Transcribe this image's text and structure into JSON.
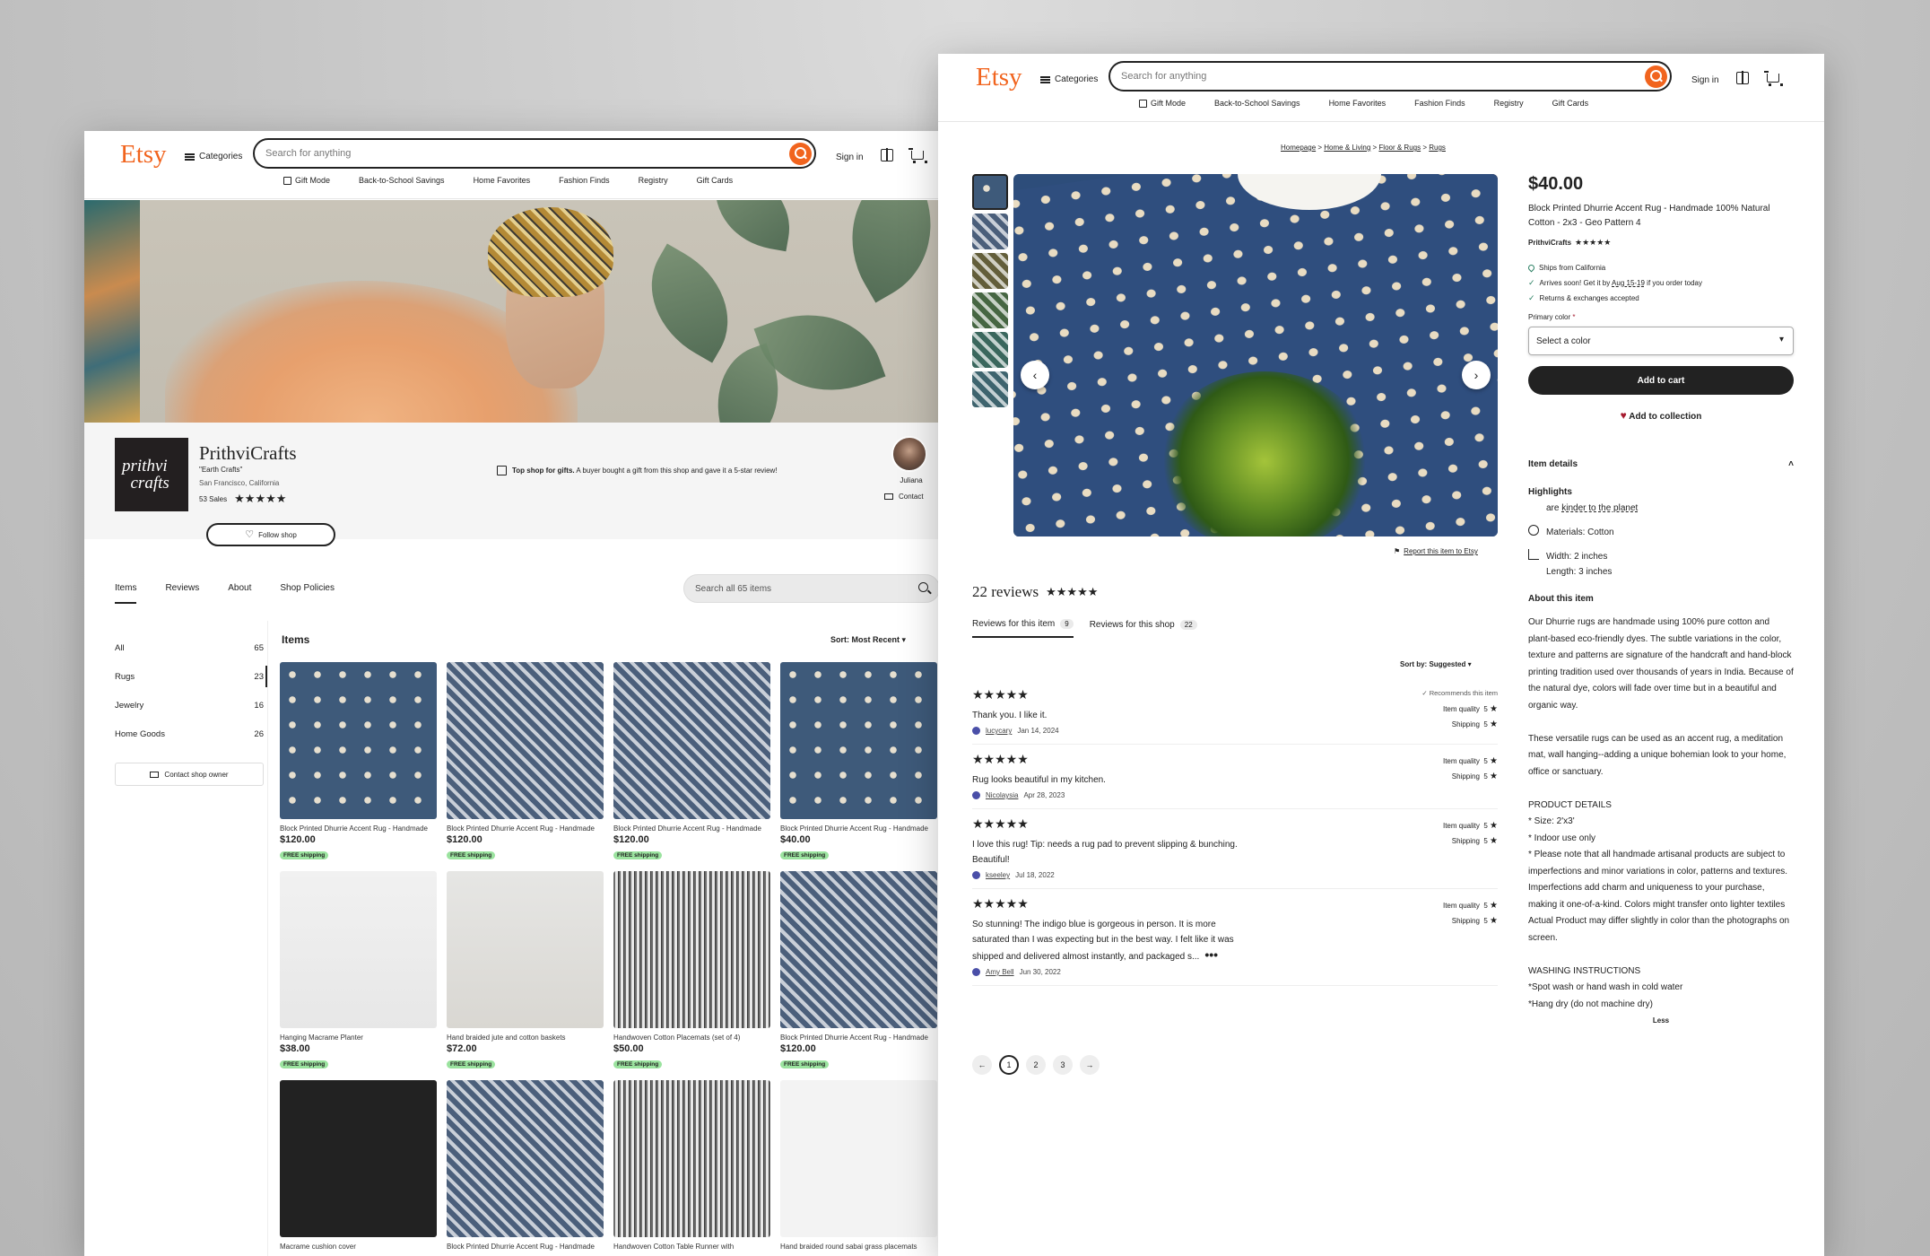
{
  "header": {
    "logo": "Etsy",
    "categories": "Categories",
    "search_placeholder": "Search for anything",
    "sign_in": "Sign in",
    "subnav": [
      "Gift Mode",
      "Back-to-School Savings",
      "Home Favorites",
      "Fashion Finds",
      "Registry",
      "Gift Cards"
    ]
  },
  "shop": {
    "logo_line1": "prithvi",
    "logo_line2": "crafts",
    "name": "PrithviCrafts",
    "tagline": "\"Earth Crafts\"",
    "location": "San Francisco, California",
    "sales": "53 Sales",
    "rating_stars": "★★★★★",
    "top_shop_bold": "Top shop for gifts.",
    "top_shop_text": " A buyer bought a gift from this shop and gave it a 5-star review!",
    "owner_name": "Juliana",
    "contact": "Contact",
    "follow": "Follow shop",
    "tabs": [
      "Items",
      "Reviews",
      "About",
      "Shop Policies"
    ],
    "search_placeholder": "Search all 65 items",
    "categories": [
      {
        "label": "All",
        "count": "65"
      },
      {
        "label": "Rugs",
        "count": "23"
      },
      {
        "label": "Jewelry",
        "count": "16"
      },
      {
        "label": "Home Goods",
        "count": "26"
      }
    ],
    "contact_owner": "Contact shop owner",
    "items_title": "Items",
    "sort": "Sort: Most Recent",
    "free_shipping": "FREE shipping",
    "listings": [
      {
        "title": "Block Printed Dhurrie Accent Rug - Handmade",
        "price": "$120.00",
        "style": "rug-blue"
      },
      {
        "title": "Block Printed Dhurrie Accent Rug - Handmade",
        "price": "$120.00",
        "style": "rug-denim"
      },
      {
        "title": "Block Printed Dhurrie Accent Rug - Handmade",
        "price": "$120.00",
        "style": "rug-denim"
      },
      {
        "title": "Block Printed Dhurrie Accent Rug - Handmade",
        "price": "$40.00",
        "style": "rug-blue"
      },
      {
        "title": "Hanging Macrame Planter",
        "price": "$38.00",
        "style": "white-wall"
      },
      {
        "title": "Hand braided jute and cotton baskets",
        "price": "$72.00",
        "style": "basket"
      },
      {
        "title": "Handwoven Cotton Placemats (set of 4)",
        "price": "$50.00",
        "style": "mat-grey"
      },
      {
        "title": "Block Printed Dhurrie Accent Rug - Handmade",
        "price": "$120.00",
        "style": "rug-denim"
      },
      {
        "title": "Macrame cushion cover",
        "price": "",
        "style": "black-bg"
      },
      {
        "title": "Block Printed Dhurrie Accent Rug - Handmade",
        "price": "",
        "style": "rug-denim"
      },
      {
        "title": "Handwoven Cotton Table Runner with",
        "price": "",
        "style": "mat-grey"
      },
      {
        "title": "Hand braided round sabai grass placemats",
        "price": "",
        "style": "brown-mats"
      }
    ]
  },
  "item": {
    "breadcrumbs": [
      "Homepage",
      "Home & Living",
      "Floor & Rugs",
      "Rugs"
    ],
    "report": "Report this item to Etsy",
    "reviews_count": "22 reviews",
    "review_tabs": [
      {
        "label": "Reviews for this item",
        "count": "9"
      },
      {
        "label": "Reviews for this shop",
        "count": "22"
      }
    ],
    "sort_by": "Sort by: Suggested",
    "recommends": "Recommends this item",
    "item_quality": "Item quality",
    "shipping": "Shipping",
    "reviews": [
      {
        "text": "Thank you. I like it.",
        "user": "lucycary",
        "date": "Jan 14, 2024",
        "q": "5",
        "s": "5",
        "rec": true
      },
      {
        "text": "Rug looks beautiful in my kitchen.",
        "user": "Nicolaysia",
        "date": "Apr 28, 2023",
        "q": "5",
        "s": "5",
        "rec": false
      },
      {
        "text": "I love this rug! Tip: needs a rug pad to prevent slipping & bunching. Beautiful!",
        "user": "kseeley",
        "date": "Jul 18, 2022",
        "q": "5",
        "s": "5",
        "rec": false
      },
      {
        "text": "So stunning! The indigo blue is gorgeous in person. It is more saturated than I was expecting but in the best way. I felt like it was shipped and delivered almost instantly, and packaged s...",
        "user": "Amy Bell",
        "date": "Jun 30, 2022",
        "q": "5",
        "s": "5",
        "rec": false
      }
    ],
    "pages": [
      "1",
      "2",
      "3"
    ],
    "price": "$40.00",
    "title": "Block Printed Dhurrie Accent Rug - Handmade 100% Natural Cotton - 2x3 - Geo Pattern 4",
    "seller": "PrithviCrafts",
    "ships_from": "Ships from California",
    "arrives_prefix": "Arrives soon! Get it by ",
    "arrives_date": "Aug 15-19",
    "arrives_suffix": " if you order today",
    "returns": "Returns & exchanges accepted",
    "primary_color": "Primary color",
    "select_color": "Select a color",
    "add_to_cart": "Add to cart",
    "add_to_collection": "Add to collection",
    "item_details": "Item details",
    "highlights": "Highlights",
    "hl_prefix": "are ",
    "hl_link": "kinder to the planet",
    "materials": "Materials: Cotton",
    "width": "Width: 2 inches",
    "length": "Length: 3 inches",
    "about_title": "About this item",
    "about_text": "Our Dhurrie rugs are handmade using 100% pure cotton and plant-based eco-friendly dyes. The subtle variations in the color, texture and patterns are signature of the handcraft and hand-block printing tradition used over thousands of years in India. Because of the natural dye, colors will fade over time but in a beautiful and organic way.\n\nThese versatile rugs can be used as an accent rug, a meditation mat, wall hanging--adding a unique bohemian look to your home, office or sanctuary.\n\nPRODUCT DETAILS\n* Size: 2'x3'\n* Indoor use only\n* Please note that all handmade artisanal products are subject to imperfections and minor variations in color, patterns and textures. Imperfections add charm and uniqueness to your purchase, making it one-of-a-kind. Colors might transfer onto lighter textiles\nActual Product may differ slightly in color than the photographs on screen.\n\nWASHING INSTRUCTIONS\n*Spot wash or hand wash in cold water\n*Hang dry (do not machine dry)",
    "less": "Less"
  },
  "colors": {
    "brand": "#f1641e",
    "free_badge": "#9be39f",
    "heart": "#a61a2e"
  }
}
